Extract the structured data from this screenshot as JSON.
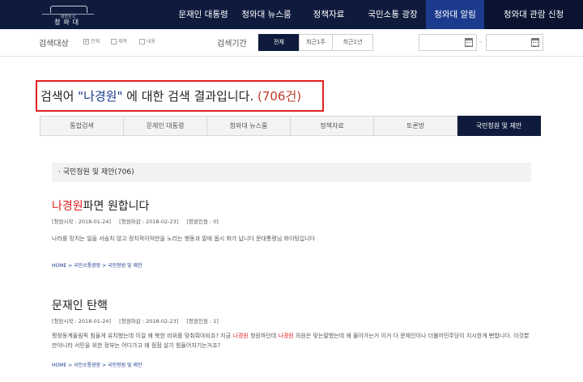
{
  "topnav": {
    "logo_sub": "대한민국",
    "logo_name": "청와대",
    "items": [
      "문재인 대통령",
      "청와대 뉴스룸",
      "정책자료",
      "국민소통 광장",
      "청와대 알림",
      "청와대 관람 신청"
    ]
  },
  "searchbar": {
    "target_label": "검색대상",
    "targets": [
      {
        "label": "전체",
        "checked": true
      },
      {
        "label": "제목",
        "checked": false
      },
      {
        "label": "내용",
        "checked": false
      }
    ],
    "period_label": "검색기간",
    "periods": [
      {
        "label": "전체",
        "active": true
      },
      {
        "label": "최근1주",
        "active": false
      },
      {
        "label": "최근1년",
        "active": false
      }
    ],
    "date_from": "",
    "date_to": "",
    "date_separator": "-"
  },
  "headline": {
    "prefix": "검색어 ",
    "keyword": "\"나경원\"",
    "suffix": " 에 대한 검색 결과입니다. ",
    "count": "(706건)"
  },
  "tabs": [
    {
      "label": "통합검색",
      "active": false
    },
    {
      "label": "문재인 대통령",
      "active": false
    },
    {
      "label": "청와대 뉴스룸",
      "active": false
    },
    {
      "label": "정책자료",
      "active": false
    },
    {
      "label": "토론방",
      "active": false
    },
    {
      "label": "국민청원 및 제안",
      "active": true
    }
  ],
  "section": {
    "title": "· 국민청원 및 제안(706)"
  },
  "results": [
    {
      "title_highlight": "나경원",
      "title_rest": "파면 원합니다",
      "meta": [
        "[청원시작 : 2018-01-24]",
        "[청원마감 : 2018-02-23]",
        "[청원인원 : 0]"
      ],
      "snippet": "나라를 망치는 일을 서슴치 않고 정치적이익만을 노리는 행동과 말에 몹시 화가 납니다 문대통령님 화이팅입니다",
      "breadcrumb": "HOME > 국민소통광장 > 국민청원 및 제안"
    },
    {
      "title_highlight": "",
      "title_rest": "문재인 탄핵",
      "meta": [
        "[청원시작 : 2018-01-24]",
        "[청원마감 : 2018-02-23]",
        "[청원인원 : 1]"
      ],
      "snippet_parts": [
        "평창동계올림픽 힘들게 유치했는데 이걸 왜 북한 비위를 맞춰줘야되죠? 지금 ",
        "나경원",
        " 청원하던데 ",
        "나경원",
        " 의원은 맞는말했는데 왜 몰아가는거 이거 다 문재인이나 더불어민주당이 지시한게 뻔합니다. 이것뿐만아니라 서민을 위한 정부는 어디가고 왜 점점 살기 힘들어지기는거죠?"
      ],
      "breadcrumb": "HOME > 국민소통광장 > 국민청원 및 제안"
    }
  ],
  "colors": {
    "nav_bg": "#0e1b3d",
    "nav_active": "#1d3b8e",
    "highlight_red": "#e02020",
    "keyword_blue": "#1a3a8f"
  }
}
